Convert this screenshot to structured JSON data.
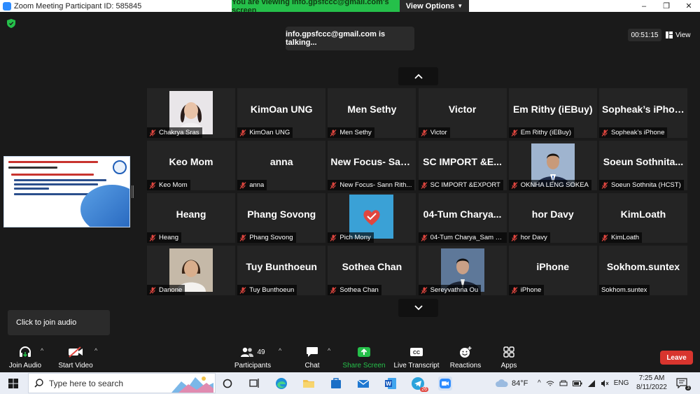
{
  "window": {
    "title": "Zoom Meeting Participant ID: 585845",
    "viewing_banner": "You are viewing info.gpsfccc@gmail.com's screen",
    "view_options": "View Options"
  },
  "top": {
    "talking": "info.gpsfccc@gmail.com is talking...",
    "timer": "00:51:15",
    "view_label": "View"
  },
  "tiles": [
    {
      "big": "",
      "label": "Chakrya Sras",
      "photo": "woman"
    },
    {
      "big": "KimOan UNG",
      "label": "KimOan UNG"
    },
    {
      "big": "Men Sethy",
      "label": "Men Sethy"
    },
    {
      "big": "Victor",
      "label": "Victor"
    },
    {
      "big": "Em Rithy (iEBuy)",
      "label": "Em Rithy (iEBuy)"
    },
    {
      "big": "Sopheak’s iPhone",
      "label": "Sopheak’s iPhone"
    },
    {
      "big": "Keo Mom",
      "label": "Keo Mom"
    },
    {
      "big": "anna",
      "label": "anna"
    },
    {
      "big": "New Focus- San...",
      "label": "New Focus- Sann Rith..."
    },
    {
      "big": "SC IMPORT &E...",
      "label": "SC IMPORT &EXPORT"
    },
    {
      "big": "",
      "label": "OKNHA LENG SOKEA",
      "photo": "man-suit"
    },
    {
      "big": "Soeun Sothnita...",
      "label": "Soeun Sothnita (HCST)"
    },
    {
      "big": "Heang",
      "label": "Heang"
    },
    {
      "big": "Phang Sovong",
      "label": "Phang Sovong"
    },
    {
      "big": "",
      "label": "Pich Mony",
      "photo": "poster"
    },
    {
      "big": "04-Tum Charya...",
      "label": "04-Tum Charya_Sam C..."
    },
    {
      "big": "hor Davy",
      "label": "hor Davy"
    },
    {
      "big": "KimLoath",
      "label": "KimLoath"
    },
    {
      "big": "",
      "label": "Danone",
      "photo": "woman2"
    },
    {
      "big": "Tuy Bunthoeun",
      "label": "Tuy Bunthoeun"
    },
    {
      "big": "Sothea Chan",
      "label": "Sothea Chan"
    },
    {
      "big": "",
      "label": "Sereyvathna Ou",
      "photo": "man2"
    },
    {
      "big": "iPhone",
      "label": "iPhone"
    },
    {
      "big": "Sokhom.suntex",
      "label": "Sokhom.suntex",
      "mic": false
    }
  ],
  "audio_tip": "Click to join audio",
  "toolbar": {
    "join_audio": "Join Audio",
    "start_video": "Start Video",
    "participants": "Participants",
    "participants_count": "49",
    "chat": "Chat",
    "share_screen": "Share Screen",
    "live_transcript": "Live Transcript",
    "reactions": "Reactions",
    "apps": "Apps",
    "leave": "Leave"
  },
  "taskbar": {
    "search_placeholder": "Type here to search",
    "weather": "84°F",
    "lang": "ENG",
    "time": "7:25 AM",
    "date": "8/11/2022",
    "telegram_badge": "26",
    "notif_count": "3"
  },
  "colors": {
    "accent_green": "#25c04a",
    "leave_red": "#d8352e",
    "muted_red": "#e0463f",
    "tile_bg": "#242424"
  }
}
